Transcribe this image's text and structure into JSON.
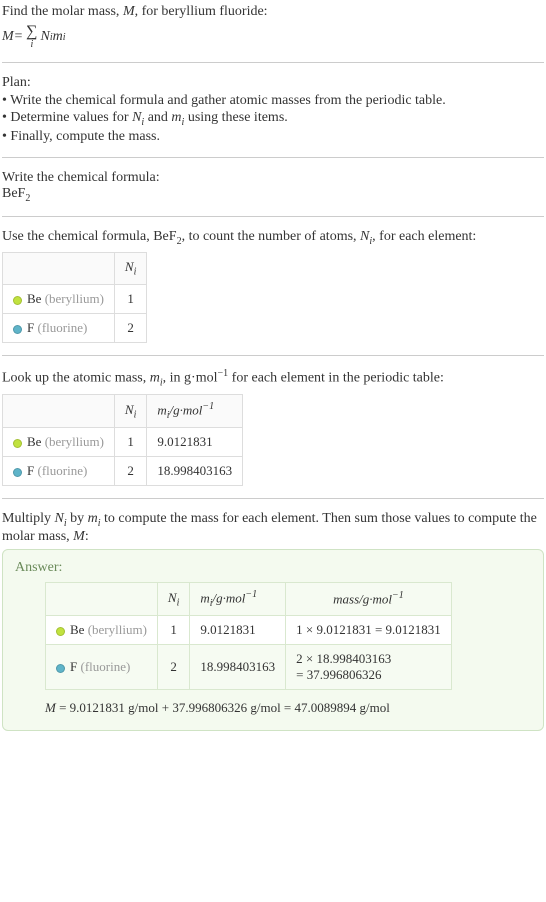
{
  "intro": {
    "line1_pre": "Find the molar mass, ",
    "line1_M": "M",
    "line1_post": ", for beryllium fluoride:",
    "eq_lhs": "M",
    "eq_eq": " = ",
    "eq_sigma": "∑",
    "eq_sigma_sub": "i",
    "eq_rhs1": "N",
    "eq_rhs1_sub": "i",
    "eq_rhs2": "m",
    "eq_rhs2_sub": "i"
  },
  "plan": {
    "heading": "Plan:",
    "items": [
      "• Write the chemical formula and gather atomic masses from the periodic table.",
      "• Determine values for Nᵢ and mᵢ using these items.",
      "• Finally, compute the mass."
    ],
    "item2_pre": "• Determine values for ",
    "item2_N": "N",
    "item2_Nsub": "i",
    "item2_mid": " and ",
    "item2_m": "m",
    "item2_msub": "i",
    "item2_post": " using these items."
  },
  "step1": {
    "heading": "Write the chemical formula:",
    "formula_base": "BeF",
    "formula_sub": "2"
  },
  "step2": {
    "text_pre": "Use the chemical formula, ",
    "formula_base": "BeF",
    "formula_sub": "2",
    "text_mid": ", to count the number of atoms, ",
    "N": "N",
    "Nsub": "i",
    "text_post": ", for each element:",
    "table": {
      "h_blank": "",
      "h_N": "N",
      "h_Nsub": "i",
      "rows": [
        {
          "dot": "be",
          "sym": "Be",
          "name": "(beryllium)",
          "n": "1"
        },
        {
          "dot": "f",
          "sym": "F",
          "name": "(fluorine)",
          "n": "2"
        }
      ]
    }
  },
  "step3": {
    "text_pre": "Look up the atomic mass, ",
    "m": "m",
    "msub": "i",
    "text_mid": ", in g·mol",
    "exp": "−1",
    "text_post": " for each element in the periodic table:",
    "table": {
      "h_N": "N",
      "h_Nsub": "i",
      "h_m": "m",
      "h_msub": "i",
      "h_unit": "/g·mol",
      "h_exp": "−1",
      "rows": [
        {
          "dot": "be",
          "sym": "Be",
          "name": "(beryllium)",
          "n": "1",
          "mass": "9.0121831"
        },
        {
          "dot": "f",
          "sym": "F",
          "name": "(fluorine)",
          "n": "2",
          "mass": "18.998403163"
        }
      ]
    }
  },
  "step4": {
    "text_pre": "Multiply ",
    "N": "N",
    "Nsub": "i",
    "text_by": " by ",
    "m": "m",
    "msub": "i",
    "text_post": " to compute the mass for each element. Then sum those values to compute the molar mass, ",
    "M": "M",
    "colon": ":"
  },
  "answer": {
    "label": "Answer:",
    "table": {
      "h_N": "N",
      "h_Nsub": "i",
      "h_m": "m",
      "h_msub": "i",
      "h_munit": "/g·mol",
      "h_mexp": "−1",
      "h_mass": "mass/g·mol",
      "h_massexp": "−1",
      "rows": [
        {
          "dot": "be",
          "sym": "Be",
          "name": "(beryllium)",
          "n": "1",
          "mi": "9.0121831",
          "calc": "1 × 9.0121831 = 9.0121831"
        },
        {
          "dot": "f",
          "sym": "F",
          "name": "(fluorine)",
          "n": "2",
          "mi": "18.998403163",
          "calc1": "2 × 18.998403163",
          "calc2": "= 37.996806326"
        }
      ]
    },
    "final_M": "M",
    "final_rest": " = 9.0121831 g/mol + 37.996806326 g/mol = 47.0089894 g/mol"
  }
}
